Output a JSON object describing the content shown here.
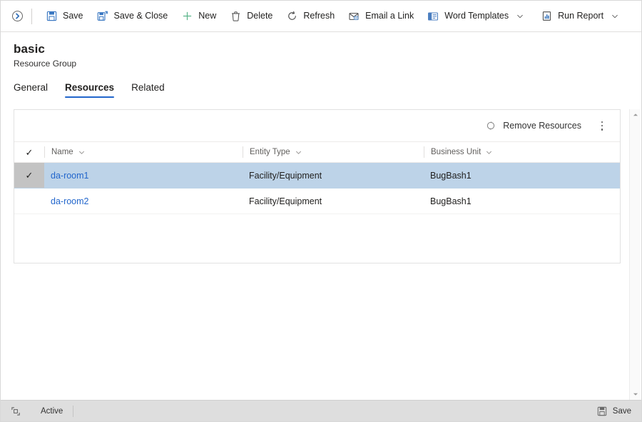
{
  "commandbar": {
    "collapse_icon": "circle-chevron-right-icon",
    "buttons": [
      {
        "id": "save",
        "icon": "save-disk-icon",
        "label": "Save",
        "caret": false
      },
      {
        "id": "save-close",
        "icon": "save-and-close-icon",
        "label": "Save & Close",
        "caret": false
      },
      {
        "id": "new",
        "icon": "plus-icon",
        "label": "New",
        "caret": false
      },
      {
        "id": "delete",
        "icon": "trash-icon",
        "label": "Delete",
        "caret": false
      },
      {
        "id": "refresh",
        "icon": "refresh-icon",
        "label": "Refresh",
        "caret": false
      },
      {
        "id": "email-a-link",
        "icon": "email-link-icon",
        "label": "Email a Link",
        "caret": false
      },
      {
        "id": "word-templates",
        "icon": "word-template-icon",
        "label": "Word Templates",
        "caret": true
      },
      {
        "id": "run-report",
        "icon": "report-chart-icon",
        "label": "Run Report",
        "caret": true
      }
    ]
  },
  "record": {
    "title": "basic",
    "subtitle": "Resource Group"
  },
  "tabs": [
    {
      "id": "general",
      "label": "General",
      "selected": false
    },
    {
      "id": "resources",
      "label": "Resources",
      "selected": true
    },
    {
      "id": "related",
      "label": "Related",
      "selected": false
    }
  ],
  "grid": {
    "toolbar": {
      "remove_icon": "remove-resources-icon",
      "remove_label": "Remove Resources",
      "overflow_label": "More commands"
    },
    "columns": [
      {
        "id": "name",
        "label": "Name",
        "sortable": true
      },
      {
        "id": "entity-type",
        "label": "Entity Type",
        "sortable": true
      },
      {
        "id": "business-unit",
        "label": "Business Unit",
        "sortable": true
      }
    ],
    "select_all_checked": true,
    "rows": [
      {
        "selected": true,
        "checked": true,
        "name": "da-room1",
        "entity_type": "Facility/Equipment",
        "business_unit": "BugBash1"
      },
      {
        "selected": false,
        "checked": false,
        "name": "da-room2",
        "entity_type": "Facility/Equipment",
        "business_unit": "BugBash1"
      }
    ]
  },
  "scrollbar": {
    "up_icon": "scroll-up-arrow-icon",
    "down_icon": "scroll-down-arrow-icon"
  },
  "statusbar": {
    "resize_icon": "popout-icon",
    "status_text": "Active",
    "save_icon": "save-disk-icon",
    "save_label": "Save"
  },
  "colors": {
    "accent": "#2266cc",
    "link": "#2266cc",
    "row_selected_bg": "#bdd3e8",
    "statusbar_bg": "#dedede"
  }
}
